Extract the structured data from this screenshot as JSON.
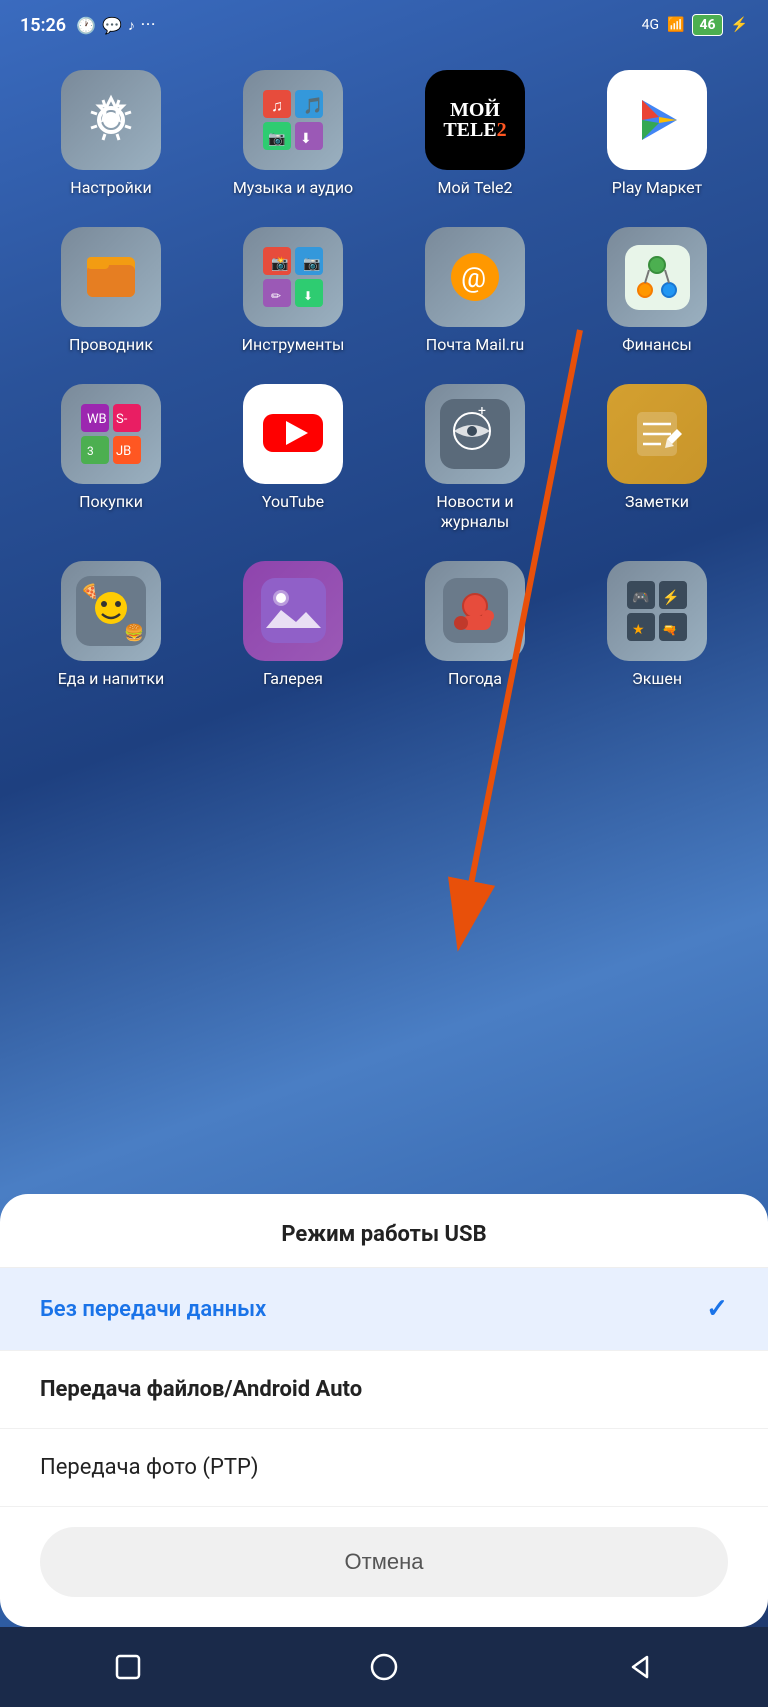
{
  "statusBar": {
    "time": "15:26",
    "batteryLevel": "46",
    "signal": "4G"
  },
  "apps": {
    "row1": [
      {
        "name": "settings-icon",
        "label": "Настройки",
        "iconType": "settings"
      },
      {
        "name": "music-icon",
        "label": "Музыка и аудио",
        "iconType": "music"
      },
      {
        "name": "tele2-icon",
        "label": "Мой Tele2",
        "iconType": "tele2"
      },
      {
        "name": "playmarket-icon",
        "label": "Play Маркет",
        "iconType": "play"
      }
    ],
    "row2": [
      {
        "name": "files-icon",
        "label": "Проводник",
        "iconType": "files"
      },
      {
        "name": "tools-icon",
        "label": "Инструменты",
        "iconType": "tools"
      },
      {
        "name": "mail-icon",
        "label": "Почта Mail.ru",
        "iconType": "mail"
      },
      {
        "name": "finance-icon",
        "label": "Финансы",
        "iconType": "finance"
      }
    ],
    "row3": [
      {
        "name": "shopping-icon",
        "label": "Покупки",
        "iconType": "shopping"
      },
      {
        "name": "youtube-icon",
        "label": "YouTube",
        "iconType": "youtube"
      },
      {
        "name": "news-icon",
        "label": "Новости и журналы",
        "iconType": "news"
      },
      {
        "name": "notes-icon",
        "label": "Заметки",
        "iconType": "notes"
      }
    ],
    "row4": [
      {
        "name": "food-icon",
        "label": "Еда и напитки",
        "iconType": "food"
      },
      {
        "name": "gallery-icon",
        "label": "Галерея",
        "iconType": "gallery"
      },
      {
        "name": "weather-icon",
        "label": "Погода",
        "iconType": "weather"
      },
      {
        "name": "games-icon",
        "label": "Экшен",
        "iconType": "games"
      }
    ]
  },
  "usbDialog": {
    "title": "Режим работы USB",
    "options": [
      {
        "id": "no-data",
        "label": "Без передачи данных",
        "selected": true
      },
      {
        "id": "file-transfer",
        "label": "Передача файлов/Android Auto",
        "selected": false
      },
      {
        "id": "photo-transfer",
        "label": "Передача фото (PTP)",
        "selected": false
      }
    ],
    "cancelLabel": "Отмена"
  },
  "navBar": {
    "homeLabel": "○",
    "backLabel": "◁",
    "recentLabel": "□"
  }
}
